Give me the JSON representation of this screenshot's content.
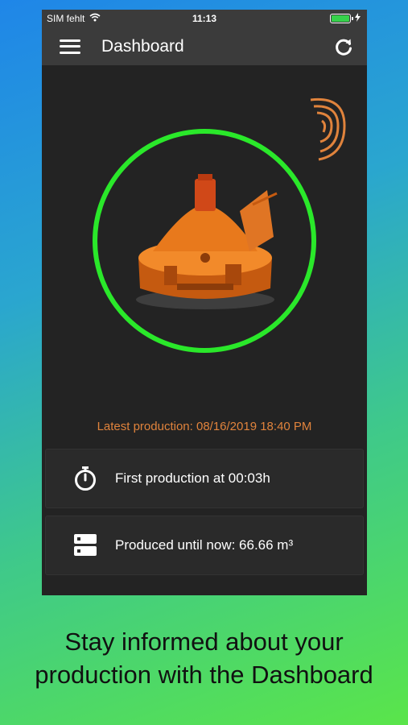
{
  "status_bar": {
    "carrier": "SIM fehlt",
    "time": "11:13",
    "battery_level": 1.0
  },
  "navbar": {
    "title": "Dashboard",
    "menu_icon": "hamburger-icon",
    "refresh_icon": "refresh-icon"
  },
  "dashboard": {
    "latest_production": "Latest production: 08/16/2019 18:40 PM",
    "cards": [
      {
        "icon": "stopwatch-icon",
        "label": "First production at 00:03h"
      },
      {
        "icon": "server-icon",
        "label": "Produced until now: 66.66 m³"
      }
    ]
  },
  "caption": {
    "line1": "Stay informed about your",
    "line2": "production with the Dashboard"
  },
  "colors": {
    "ring": "#2ae82a",
    "accent_orange": "#e0833c",
    "panel": "#232323",
    "bar": "#3b3b3b"
  }
}
